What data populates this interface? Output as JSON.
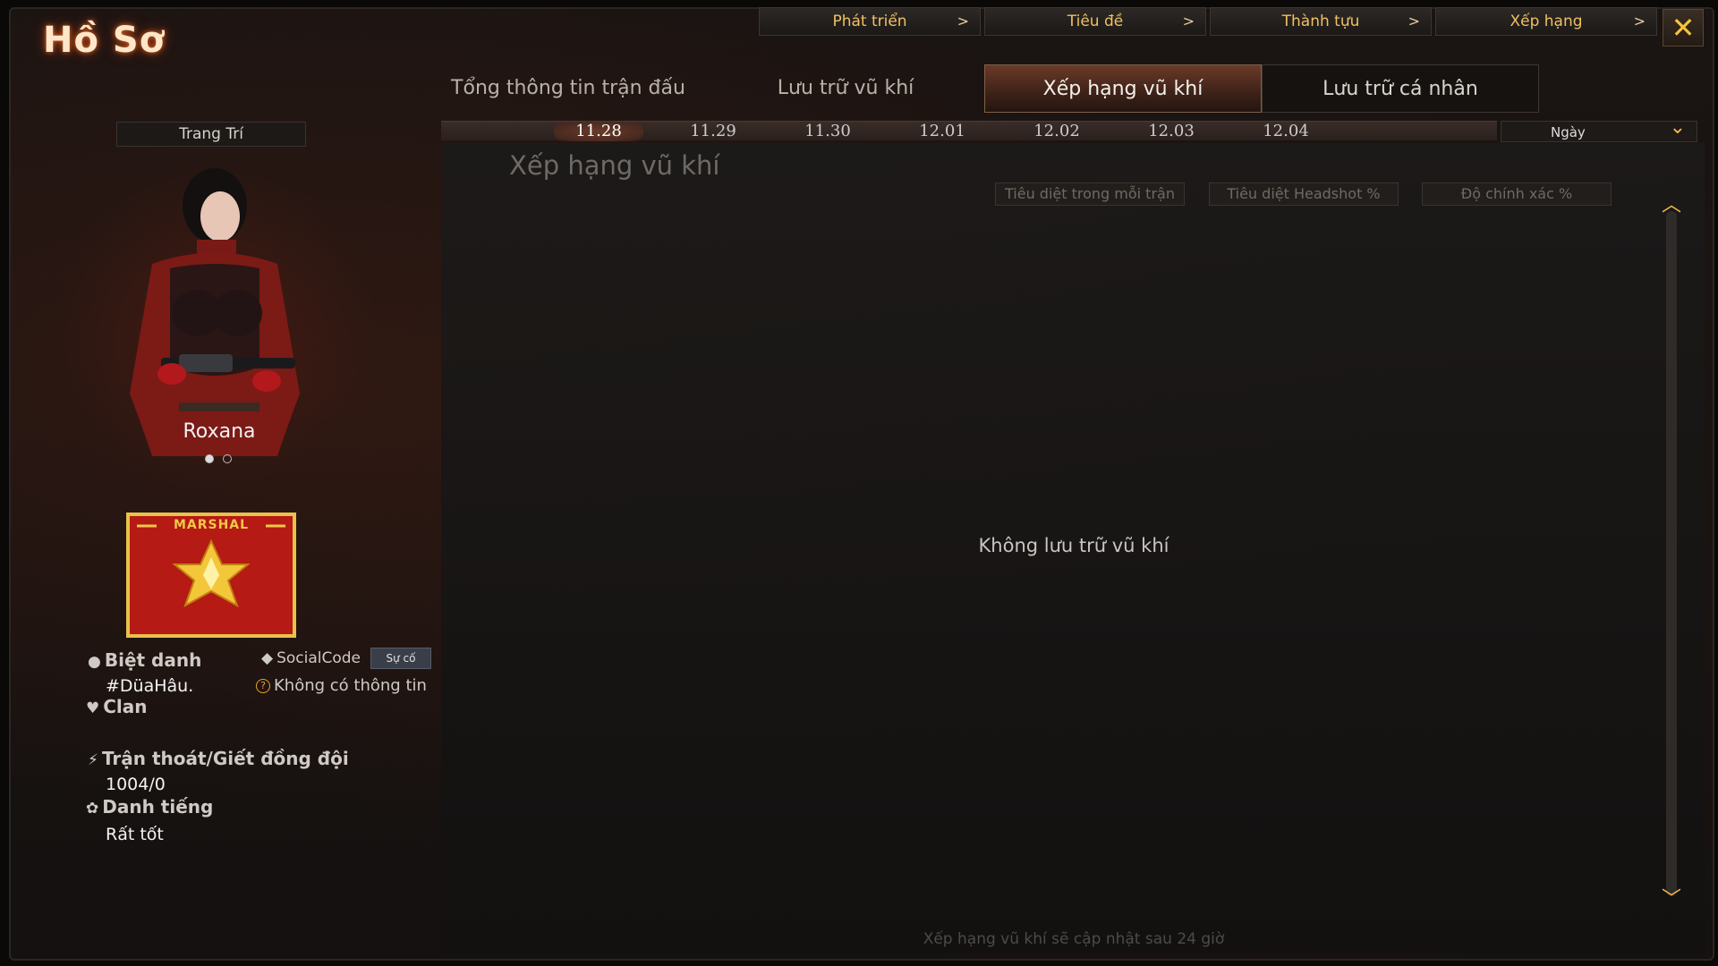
{
  "window": {
    "title": "Hồ Sơ"
  },
  "top_nav": [
    {
      "label": "Phát triển",
      "arrow": ">"
    },
    {
      "label": "Tiêu đề",
      "arrow": ">"
    },
    {
      "label": "Thành tựu",
      "arrow": ">"
    },
    {
      "label": "Xếp hạng",
      "arrow": ">"
    }
  ],
  "close_label": "✕",
  "tabs": [
    {
      "label": "Tổng thông tin trận đấu",
      "active": false
    },
    {
      "label": "Lưu trữ vũ khí",
      "active": false
    },
    {
      "label": "Xếp hạng vũ khí",
      "active": true
    },
    {
      "label": "Lưu trữ cá nhân",
      "active": false
    }
  ],
  "dates": [
    "11.28",
    "11.29",
    "11.30",
    "12.01",
    "12.02",
    "12.03",
    "12.04"
  ],
  "selected_date": "11.28",
  "period_select": {
    "label": "Ngày",
    "chevron": "⌄"
  },
  "panel": {
    "title": "Xếp hạng vũ khí",
    "sort_buttons": [
      "Tiêu diệt trong mỗi trận",
      "Tiêu diệt Headshot %",
      "Độ chính xác %"
    ],
    "empty_message": "Không lưu trữ vũ khí",
    "footer_note": "Xếp hạng vũ khí sẽ cập nhật sau 24 giờ"
  },
  "sidebar": {
    "decoration_button": "Trang Trí",
    "character_name": "Roxana",
    "rank_name": "MARSHAL",
    "nickname_label": "Biệt danh",
    "nickname_value": "#DüaHâu.",
    "social_code_label": "SocialCode",
    "report_button": "Sự cố",
    "social_code_value": "Không có thông tin",
    "clan_label": "Clan",
    "desert_label": "Trận thoát/Giết đồng đội",
    "desert_value": "1004/0",
    "reputation_label": "Danh tiếng",
    "reputation_value": "Rất tốt"
  },
  "colors": {
    "accent_gold": "#f0c060",
    "active_tab": "#6a3a28",
    "rank_red": "#b51a14",
    "rank_border": "#e9c24a"
  }
}
